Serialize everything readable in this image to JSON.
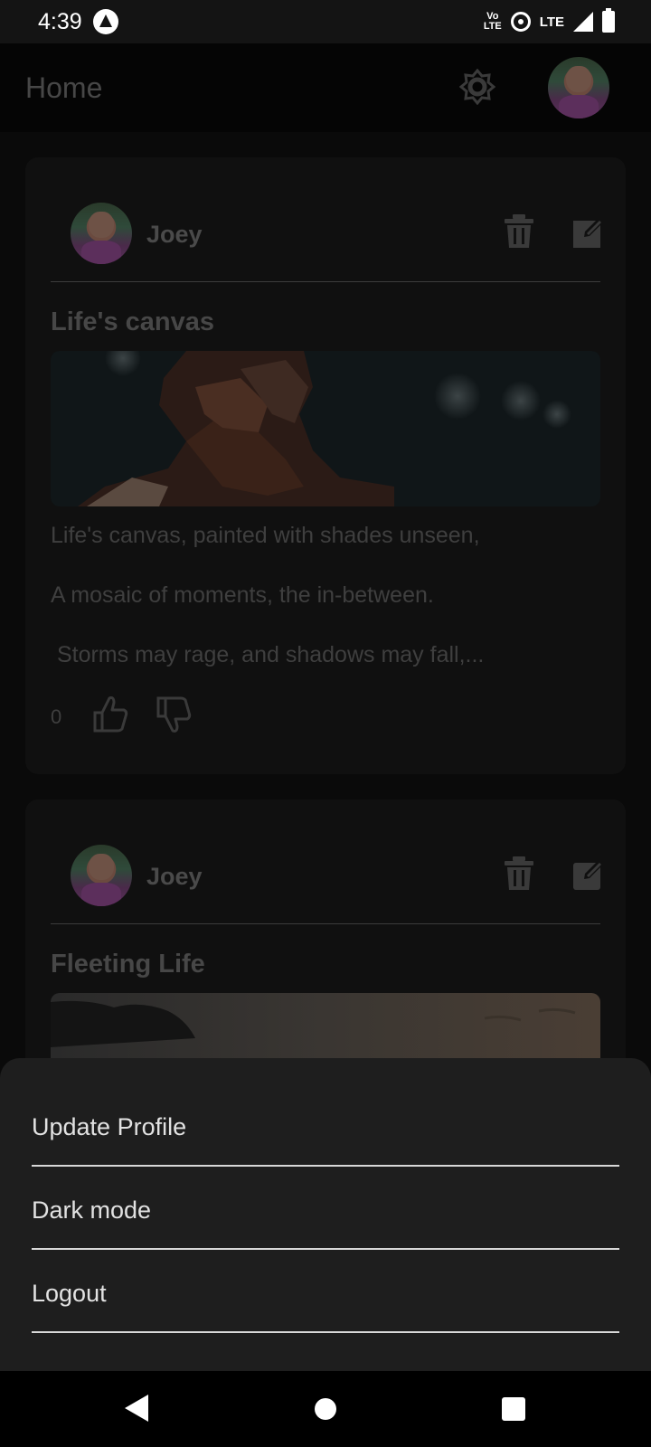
{
  "status_bar": {
    "time": "4:39",
    "volte_top": "Vo",
    "volte_bottom": "LTE",
    "network": "LTE"
  },
  "app_bar": {
    "title": "Home",
    "theme_icon": "brightness-icon",
    "avatar_icon": "profile-avatar"
  },
  "posts": [
    {
      "author": "Joey",
      "title": "Life's canvas",
      "lines": [
        "Life's canvas, painted with shades unseen,",
        "A mosaic of moments, the in-between.",
        " Storms may rage, and shadows may fall,..."
      ],
      "reaction_count": "0"
    },
    {
      "author": "Joey",
      "title": "Fleeting Life"
    }
  ],
  "menu": {
    "items": [
      "Update Profile",
      "Dark mode",
      "Logout"
    ]
  },
  "colors": {
    "background": "#0a0a0a",
    "card": "#101010",
    "sheet": "#1e1e1e",
    "dim_text": "#474747"
  }
}
